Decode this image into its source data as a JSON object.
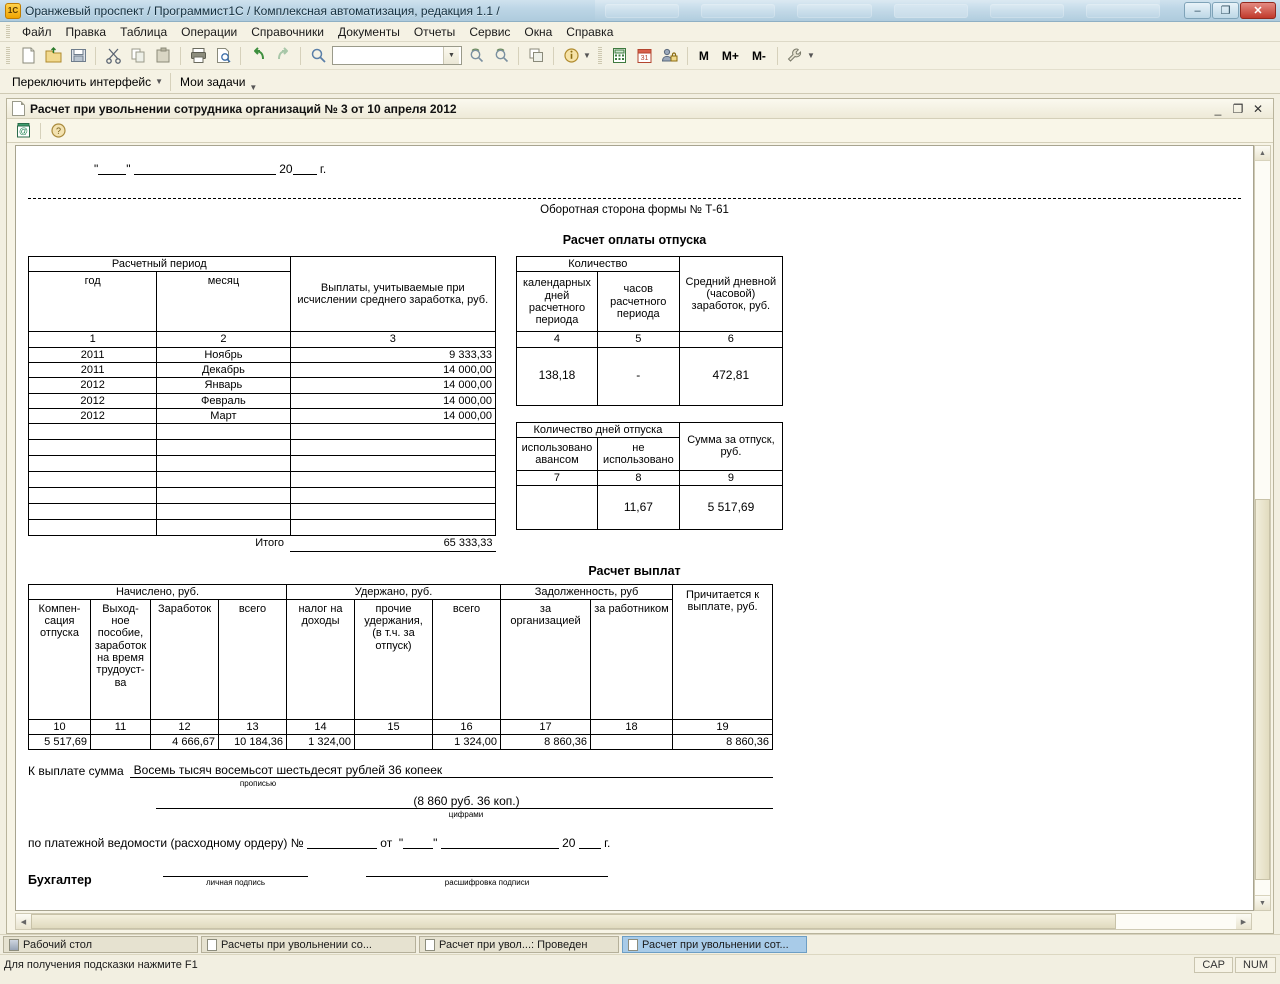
{
  "window": {
    "title": "Оранжевый проспект / Программист1С /  Комплексная автоматизация, редакция 1.1 /",
    "app_icon": "1c-logo-icon",
    "minimize": "–",
    "restore": "❐",
    "close": "✕"
  },
  "menubar": {
    "items": [
      {
        "label": "Файл",
        "accel": "Ф"
      },
      {
        "label": "Правка",
        "accel": "П"
      },
      {
        "label": "Таблица",
        "accel": ""
      },
      {
        "label": "Операции",
        "accel": ""
      },
      {
        "label": "Справочники",
        "accel": ""
      },
      {
        "label": "Документы",
        "accel": ""
      },
      {
        "label": "Отчеты",
        "accel": ""
      },
      {
        "label": "Сервис",
        "accel": "С"
      },
      {
        "label": "Окна",
        "accel": "О"
      },
      {
        "label": "Справка",
        "accel": ""
      }
    ]
  },
  "toolbar": {
    "icons": [
      {
        "name": "new-document-icon",
        "tip": "Новый"
      },
      {
        "name": "open-folder-icon",
        "tip": "Открыть"
      },
      {
        "name": "save-icon",
        "tip": "Сохранить"
      },
      {
        "name": "cut-icon",
        "tip": "Вырезать"
      },
      {
        "name": "copy-icon",
        "tip": "Копировать"
      },
      {
        "name": "paste-icon",
        "tip": "Вставить"
      },
      {
        "name": "print-icon",
        "tip": "Печать"
      },
      {
        "name": "print-preview-icon",
        "tip": "Предварительный просмотр"
      },
      {
        "name": "undo-icon",
        "tip": "Отменить"
      },
      {
        "name": "redo-icon",
        "tip": "Вернуть"
      },
      {
        "name": "find-icon",
        "tip": "Найти"
      }
    ],
    "search_value": "",
    "search_placeholder": "",
    "icons2": [
      {
        "name": "find-next-icon",
        "tip": "Найти следующий"
      },
      {
        "name": "find-prev-icon",
        "tip": "Найти предыдущий"
      },
      {
        "name": "windows-icon",
        "tip": "Окна"
      },
      {
        "name": "info-icon",
        "tip": "Информация"
      }
    ],
    "icons3": [
      {
        "name": "calculator-icon",
        "tip": "Калькулятор"
      },
      {
        "name": "calendar-icon",
        "tip": "Календарь"
      },
      {
        "name": "user-lock-icon",
        "tip": "Активные пользователи"
      }
    ],
    "memory": [
      {
        "name": "memory-recall-button",
        "label": "M"
      },
      {
        "name": "memory-add-button",
        "label": "M+"
      },
      {
        "name": "memory-subtract-button",
        "label": "M-"
      }
    ],
    "tools_icon": {
      "name": "wrench-icon",
      "tip": "Настройка"
    }
  },
  "toolbar2": {
    "switch_interface": "Переключить интерфейс",
    "my_tasks": "Мои задачи"
  },
  "document_window": {
    "title": "Расчет при увольнении сотрудника организаций № 3 от 10 апреля 2012",
    "minimize": "_",
    "restore": "❐",
    "close": "✕",
    "toolbar": [
      {
        "name": "save-to-file-icon",
        "tip": "Сохранить"
      },
      {
        "name": "help-icon",
        "tip": "Справка"
      }
    ]
  },
  "form": {
    "date_prefix": "\"",
    "date_quote_close": "\"",
    "year_prefix": "20",
    "year_suffix": "г.",
    "backside_note": "Оборотная сторона формы № Т-61",
    "section1_title": "Расчет оплаты отпуска",
    "section2_title": "Расчет выплат",
    "table_period": {
      "group_header": "Расчетный период",
      "col_payments": "Выплаты, учитываемые при исчислении среднего заработка, руб.",
      "col_year": "год",
      "col_month": "месяц",
      "numbers": [
        "1",
        "2",
        "3"
      ],
      "rows": [
        {
          "year": "2011",
          "month": "Ноябрь",
          "amount": "9 333,33"
        },
        {
          "year": "2011",
          "month": "Декабрь",
          "amount": "14 000,00"
        },
        {
          "year": "2012",
          "month": "Январь",
          "amount": "14 000,00"
        },
        {
          "year": "2012",
          "month": "Февраль",
          "amount": "14 000,00"
        },
        {
          "year": "2012",
          "month": "Март",
          "amount": "14 000,00"
        },
        {
          "year": "",
          "month": "",
          "amount": ""
        },
        {
          "year": "",
          "month": "",
          "amount": ""
        },
        {
          "year": "",
          "month": "",
          "amount": ""
        },
        {
          "year": "",
          "month": "",
          "amount": ""
        },
        {
          "year": "",
          "month": "",
          "amount": ""
        },
        {
          "year": "",
          "month": "",
          "amount": ""
        },
        {
          "year": "",
          "month": "",
          "amount": ""
        }
      ],
      "total_label": "Итого",
      "total_value": "65 333,33"
    },
    "table_quantity": {
      "group_header": "Количество",
      "col_cal_days": "календарных дней расчетного периода",
      "col_hours": "часов расчетного периода",
      "col_avg": "Средний дневной (часовой) заработок, руб.",
      "numbers": [
        "4",
        "5",
        "6"
      ],
      "values": [
        "138,18",
        "-",
        "472,81"
      ]
    },
    "table_vacation_days": {
      "group_header": "Количество дней отпуска",
      "col_advance": "использовано авансом",
      "col_unused": "не использовано",
      "col_sum": "Сумма за отпуск, руб.",
      "numbers": [
        "7",
        "8",
        "9"
      ],
      "values": [
        "",
        "11,67",
        "5 517,69"
      ]
    },
    "table_payments": {
      "group_accrued": "Начислено, руб.",
      "group_withheld": "Удержано, руб.",
      "group_debt": "Задолженность, руб",
      "col_due": "Причитается к выплате, руб.",
      "cols": [
        "Компен-сация отпуска",
        "Выход-ное пособие, заработок на время трудоуст-ва",
        "Заработок",
        "всего",
        "налог на доходы",
        "прочие удержания, (в т.ч. за отпуск)",
        "всего",
        "за организацией",
        "за работником"
      ],
      "numbers": [
        "10",
        "11",
        "12",
        "13",
        "14",
        "15",
        "16",
        "17",
        "18",
        "19"
      ],
      "values": [
        "5 517,69",
        "",
        "4 666,67",
        "10 184,36",
        "1 324,00",
        "",
        "1 324,00",
        "8 860,36",
        "",
        "8 860,36"
      ]
    },
    "payout": {
      "label": "К выплате сумма",
      "amount_words": "Восемь тысяч восемьсот шестьдесят рублей 36 копеек",
      "caption_words": "прописью",
      "amount_digits": "(8 860 руб. 36 коп.)",
      "caption_digits": "цифрами",
      "statement_prefix": "по платежной ведомости (расходному ордеру) №",
      "statement_from": "от",
      "statement_year": "20",
      "statement_suffix": "г.",
      "accountant_label": "Бухгалтер",
      "caption_signature": "личная подпись",
      "caption_decode": "расшифровка  подписи"
    }
  },
  "taskbar": {
    "items": [
      {
        "label": "Рабочий стол",
        "icon": "desktop-icon",
        "active": false
      },
      {
        "label": "Расчеты при увольнении со...",
        "icon": "list-icon",
        "active": false
      },
      {
        "label": "Расчет при увол...: Проведен",
        "icon": "document-icon",
        "active": false
      },
      {
        "label": "Расчет при увольнении сот...",
        "icon": "document-icon",
        "active": true
      }
    ]
  },
  "statusbar": {
    "hint": "Для получения подсказки нажмите F1",
    "cells": [
      "CAP",
      "NUM"
    ]
  }
}
